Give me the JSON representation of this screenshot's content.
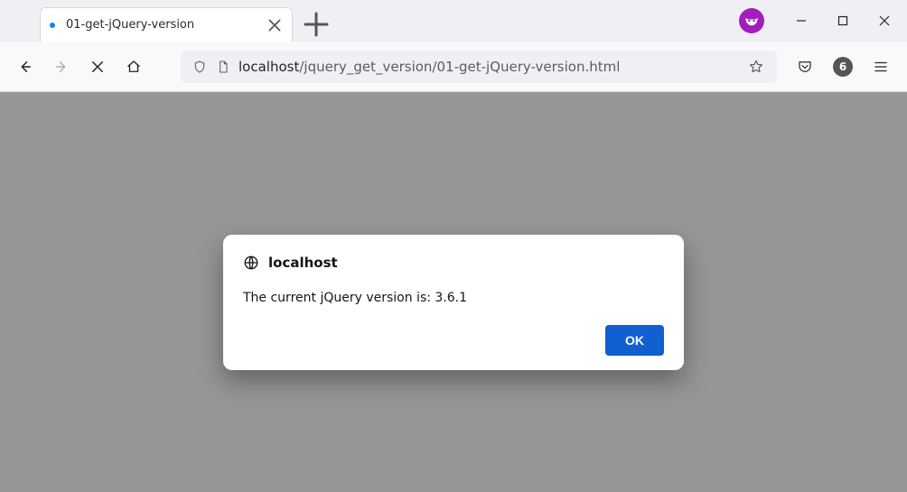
{
  "tab": {
    "title": "01-get-jQuery-version"
  },
  "url": {
    "host": "localhost",
    "path": "/jquery_get_version/01-get-jQuery-version.html"
  },
  "toolbar": {
    "notification_count": "6"
  },
  "dialog": {
    "origin": "localhost",
    "message": "The current jQuery version is: 3.6.1",
    "ok_label": "OK"
  }
}
